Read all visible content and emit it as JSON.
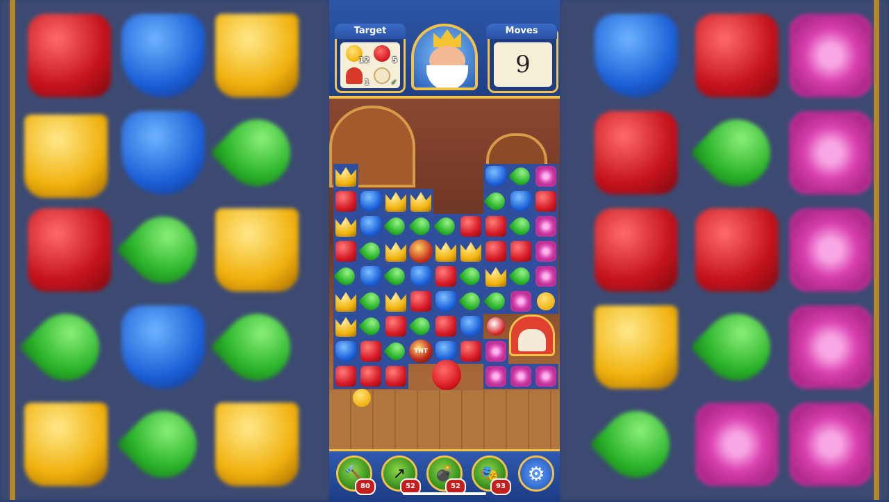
{
  "header": {
    "target_title": "Target",
    "moves_title": "Moves",
    "moves_value": "9",
    "targets": [
      {
        "name": "duck-target",
        "count": "12"
      },
      {
        "name": "red-bird-target",
        "count": "5"
      },
      {
        "name": "doghouse-target",
        "count": "1"
      },
      {
        "name": "teacup-target",
        "count": "✓"
      }
    ]
  },
  "board": {
    "special_labels": {
      "tnt": "TNT"
    }
  },
  "boosters": [
    {
      "name": "hammer-booster",
      "icon": "hammer-icon",
      "glyph": "🔨",
      "count": "80"
    },
    {
      "name": "arrow-booster",
      "icon": "arrow-icon",
      "glyph": "↗",
      "count": "52"
    },
    {
      "name": "cannon-booster",
      "icon": "cannon-icon",
      "glyph": "💣",
      "count": "52"
    },
    {
      "name": "jester-booster",
      "icon": "jester-hat-icon",
      "glyph": "🎭",
      "count": "93"
    }
  ],
  "settings_glyph": "⚙",
  "colors": {
    "accent_gold": "#f2c24a",
    "panel_blue": "#1f3d80",
    "tile_red": "#d51924",
    "tile_blue": "#1d62db",
    "tile_green": "#2cb52c",
    "tile_yellow": "#f2b40f",
    "tile_pink": "#db45b3"
  }
}
